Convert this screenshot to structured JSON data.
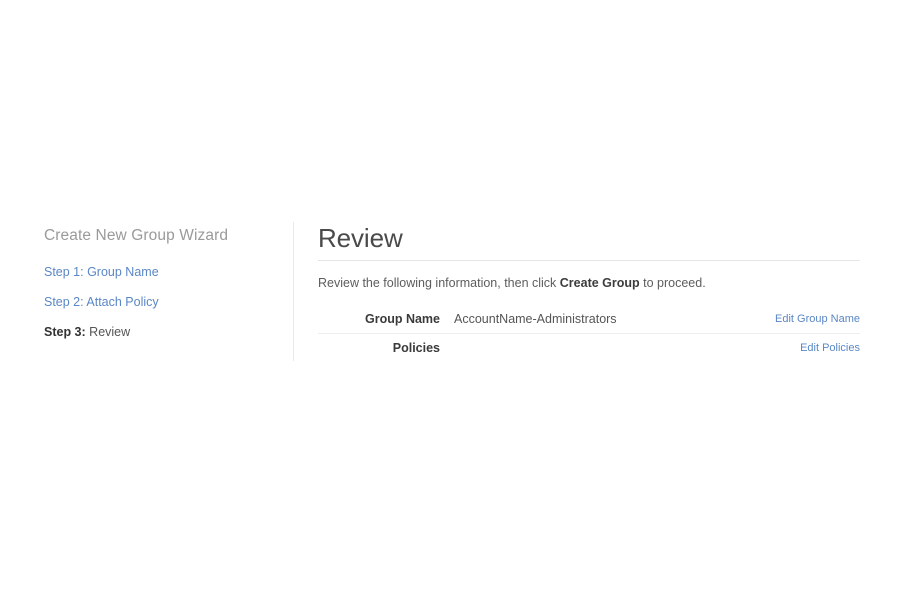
{
  "wizard": {
    "title": "Create New Group Wizard",
    "steps": [
      {
        "label": "Step 1: Group Name",
        "state": "link"
      },
      {
        "label": "Step 2: Attach Policy",
        "state": "link"
      },
      {
        "num": "Step 3:",
        "name": "Review",
        "state": "current"
      }
    ]
  },
  "panel": {
    "heading": "Review",
    "intro_before": "Review the following information, then click ",
    "intro_bold": "Create Group",
    "intro_after": " to proceed.",
    "rows": [
      {
        "label": "Group Name",
        "value": "AccountName-Administrators",
        "action": "Edit Group Name"
      },
      {
        "label": "Policies",
        "value": "",
        "action": "Edit Policies"
      }
    ]
  },
  "colors": {
    "link": "#5a87c5",
    "heading": "#4a4a4a",
    "muted": "#9a9a9a",
    "rule": "#e6e6e6",
    "background": "#ffffff"
  }
}
